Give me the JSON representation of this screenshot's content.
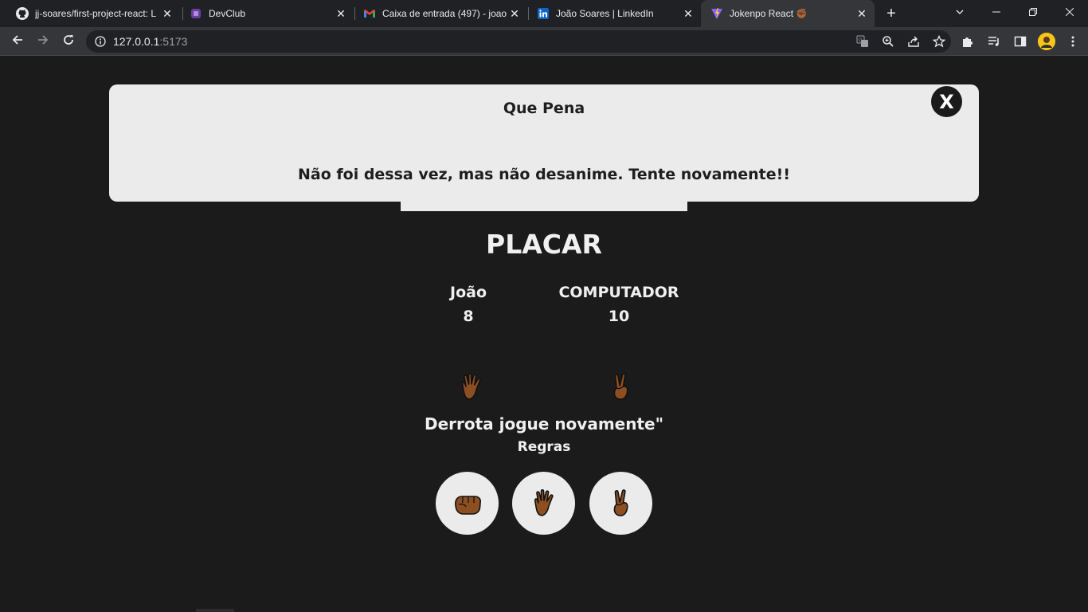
{
  "browser": {
    "tabs": [
      {
        "title": "jj-soares/first-project-react: L",
        "icon": "github-icon"
      },
      {
        "title": "DevClub",
        "icon": "devclub-icon"
      },
      {
        "title": "Caixa de entrada (497) - joao",
        "icon": "gmail-icon"
      },
      {
        "title": "João Soares | LinkedIn",
        "icon": "linkedin-icon"
      },
      {
        "title": "Jokenpo React ✊🏾",
        "icon": "vite-icon",
        "active": true
      }
    ],
    "url_host": "127.0.0.1",
    "url_port": ":5173"
  },
  "modal": {
    "title": "Que Pena",
    "message": "Não foi dessa vez, mas não desanime. Tente novamente!!",
    "close_label": "X"
  },
  "scoreboard": {
    "title": "PLACAR",
    "player": {
      "name": "João",
      "score": "8"
    },
    "computer": {
      "name": "COMPUTADOR",
      "score": "10"
    }
  },
  "last_round": {
    "player_choice": "paper-hand-icon",
    "computer_choice": "scissors-hand-icon"
  },
  "result_text": "Derrota jogue novamente\"",
  "rules_label": "Regras",
  "choices": [
    "rock-fist-icon",
    "paper-hand-icon",
    "scissors-hand-icon"
  ],
  "colors": {
    "page_bg": "#1b1b1b",
    "modal_bg": "#ebebeb",
    "text": "#f0f0f0",
    "skin": "#8d4f22"
  }
}
